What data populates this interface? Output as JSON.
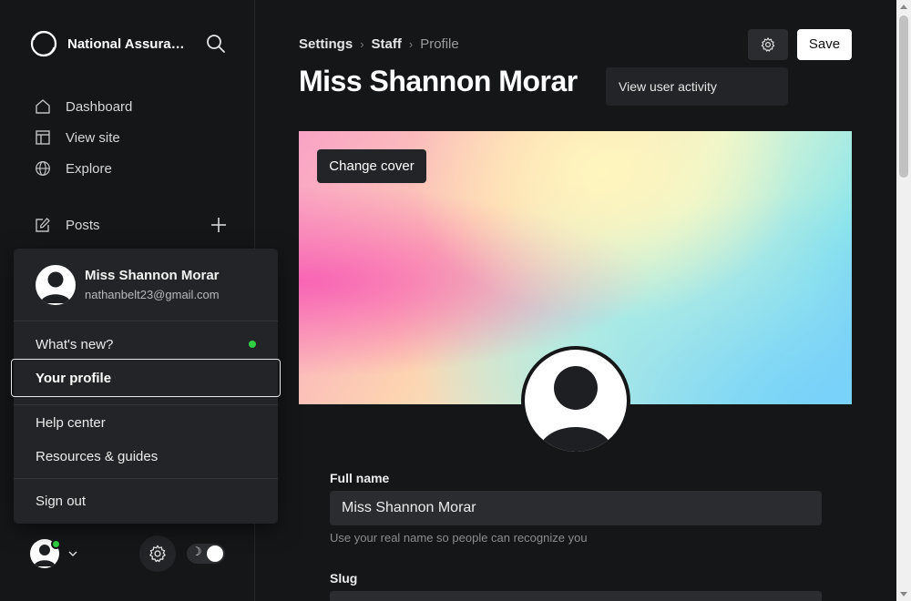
{
  "brand": {
    "name": "National Assurance Group",
    "logo_icon": "brand-ring-icon"
  },
  "sidebar": {
    "items": [
      {
        "label": "Dashboard",
        "icon": "home-icon"
      },
      {
        "label": "View site",
        "icon": "layout-icon"
      },
      {
        "label": "Explore",
        "icon": "globe-icon"
      }
    ],
    "posts": {
      "label": "Posts",
      "icon": "edit-icon",
      "add_icon": "plus-icon"
    }
  },
  "user_menu": {
    "name": "Miss Shannon Morar",
    "email": "nathanbelt23@gmail.com",
    "whats_new": "What's new?",
    "your_profile": "Your profile",
    "help_center": "Help center",
    "resources": "Resources & guides",
    "sign_out": "Sign out",
    "status_color": "#30cf43"
  },
  "breadcrumb": {
    "settings": "Settings",
    "staff": "Staff",
    "current": "Profile",
    "separator": "›"
  },
  "page": {
    "title": "Miss Shannon Morar",
    "view_activity": "View user activity",
    "save": "Save"
  },
  "cover": {
    "change_label": "Change cover"
  },
  "form": {
    "full_name_label": "Full name",
    "full_name_value": "Miss Shannon Morar",
    "full_name_help": "Use your real name so people can recognize you",
    "slug_label": "Slug"
  },
  "theme": {
    "moon_glyph": "☽"
  },
  "colors": {
    "background": "#151618",
    "panel": "#222427",
    "accent_online": "#30cf43",
    "save_button": "#ffffff"
  }
}
